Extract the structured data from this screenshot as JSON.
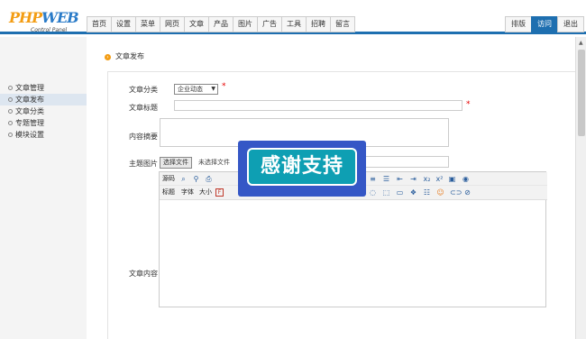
{
  "logo": {
    "brand_left": "PHP",
    "brand_right": "WEB",
    "subtitle": "Control Panel"
  },
  "top_nav": [
    "首页",
    "设置",
    "菜单",
    "网页",
    "文章",
    "产品",
    "图片",
    "广告",
    "工具",
    "招聘",
    "留言"
  ],
  "right_nav": [
    {
      "label": "排版",
      "active": false
    },
    {
      "label": "访问",
      "active": true
    },
    {
      "label": "退出",
      "active": false
    }
  ],
  "sidebar": {
    "items": [
      {
        "label": "文章管理",
        "active": false
      },
      {
        "label": "文章发布",
        "active": true
      },
      {
        "label": "文章分类",
        "active": false
      },
      {
        "label": "专题管理",
        "active": false
      },
      {
        "label": "模块设置",
        "active": false
      }
    ]
  },
  "breadcrumb": {
    "title": "文章发布"
  },
  "form": {
    "category_label": "文章分类",
    "category_value": "企业动态",
    "title_label": "文章标题",
    "title_value": "",
    "summary_label": "内容摘要",
    "summary_value": "",
    "image_label": "主题图片",
    "file_button": "选择文件",
    "file_status": "未选择文件",
    "content_label": "文章内容",
    "required_mark": "*"
  },
  "editor": {
    "toolbar1_source": "源码",
    "toolbar2": [
      "标题",
      "字体",
      "大小"
    ]
  },
  "popup": {
    "text": "感谢支持"
  }
}
